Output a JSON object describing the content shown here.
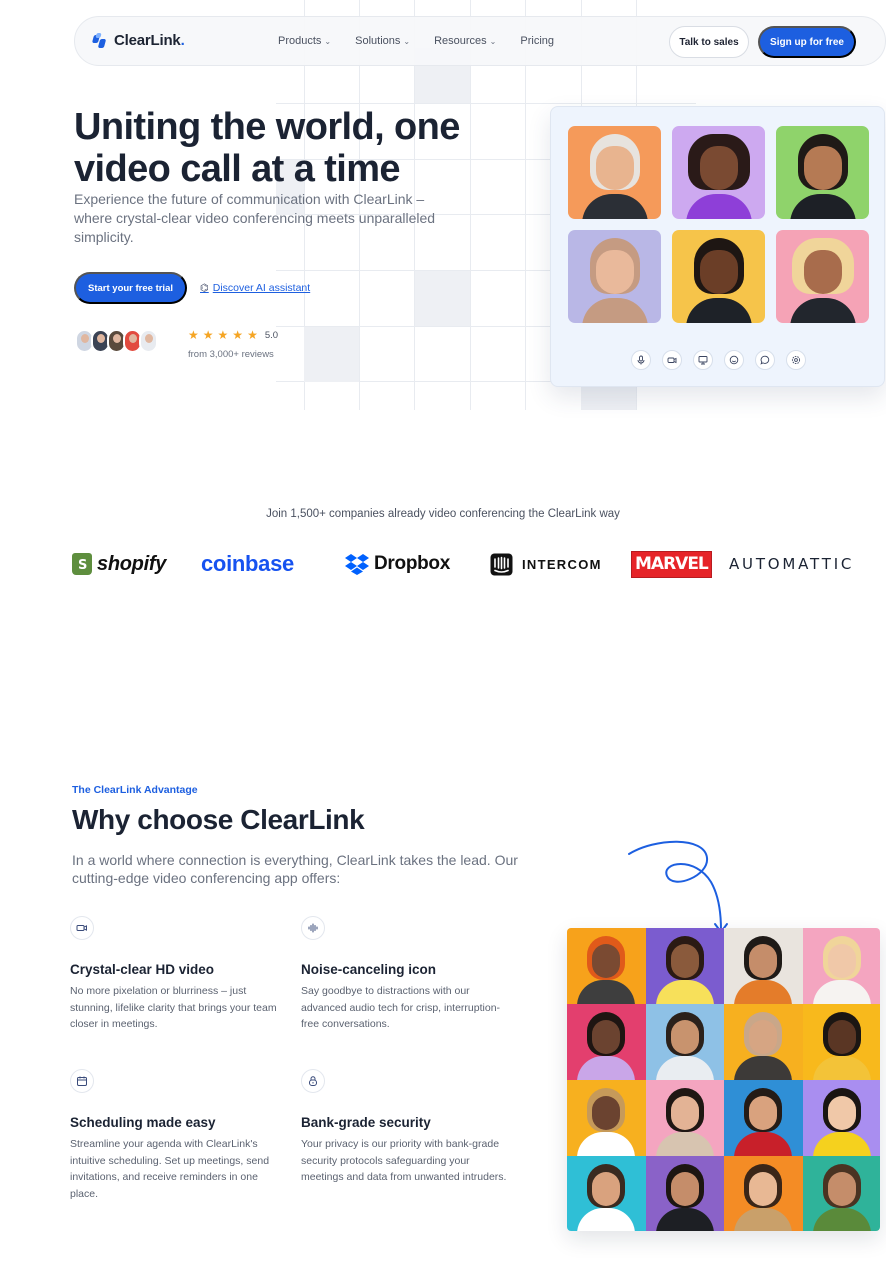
{
  "nav": {
    "brand": "ClearLink",
    "brand_dot": ".",
    "menu": [
      {
        "label": "Products"
      },
      {
        "label": "Solutions"
      },
      {
        "label": "Resources"
      },
      {
        "label": "Pricing"
      }
    ],
    "talk_to_sales": "Talk to sales",
    "sign_up": "Sign up for free"
  },
  "hero": {
    "title": "Uniting the world, one video call at a time",
    "subtitle": "Experience the future of communication with ClearLink – where crystal-clear video conferencing meets unparalleled simplicity.",
    "cta_primary": "Start your free trial",
    "cta_secondary": "Discover AI assistant",
    "rating": "5.0",
    "reviews": "from 3,000+ reviews",
    "star_count": 5
  },
  "video_card": {
    "participants": [
      {
        "name": "older-man-avatar",
        "bg": "#f59a5a"
      },
      {
        "name": "curly-woman-avatar",
        "bg": "#cda9f0"
      },
      {
        "name": "bearded-man-avatar",
        "bg": "#8fd36b"
      },
      {
        "name": "hijab-woman-avatar",
        "bg": "#b9b7e6"
      },
      {
        "name": "glasses-man-avatar",
        "bg": "#f6c44a"
      },
      {
        "name": "blonde-woman-avatar",
        "bg": "#f5a3b6"
      }
    ],
    "controls": [
      {
        "name": "microphone-icon",
        "glyph": "🎙"
      },
      {
        "name": "camera-icon",
        "glyph": "▭"
      },
      {
        "name": "screen-share-icon",
        "glyph": "▢"
      },
      {
        "name": "emoji-icon",
        "glyph": "☺"
      },
      {
        "name": "chat-icon",
        "glyph": "◌"
      },
      {
        "name": "settings-icon",
        "glyph": "⚙"
      }
    ]
  },
  "companies": {
    "heading": "Join 1,500+ companies already video conferencing the ClearLink way",
    "logos": [
      "shopify",
      "coinbase",
      "Dropbox",
      "INTERCOM",
      "MARVEL",
      "AUTOMATTIC"
    ]
  },
  "advantage": {
    "eyebrow": "The ClearLink Advantage",
    "title": "Why choose ClearLink",
    "subtitle": "In a world where connection is everything, ClearLink takes the lead. Our cutting-edge video conferencing app offers:",
    "features": [
      {
        "icon": "video-icon",
        "glyph": "▭",
        "title": "Crystal-clear HD video",
        "desc": "No more pixelation or blurriness – just stunning, lifelike clarity that brings your team closer in meetings."
      },
      {
        "icon": "soundwave-icon",
        "glyph": "⦙",
        "title": "Noise-canceling icon",
        "desc": "Say goodbye to distractions with our advanced audio tech for crisp, interruption-free conversations."
      },
      {
        "icon": "calendar-icon",
        "glyph": "▤",
        "title": "Scheduling made easy",
        "desc": "Streamline your agenda with ClearLink's intuitive scheduling. Set up meetings, send invitations, and receive reminders in one place."
      },
      {
        "icon": "lock-icon",
        "glyph": "⊕",
        "title": "Bank-grade security",
        "desc": "Your privacy is our priority with bank-grade security protocols safeguarding your meetings and data from unwanted intruders."
      }
    ]
  },
  "colors": {
    "primary": "#1d5fe0",
    "heading": "#1b2333",
    "muted": "#6b7280",
    "star": "#f5a524"
  },
  "people_grid": [
    "#f7a21b",
    "#7b5ccf",
    "#e9e4de",
    "#f4a5c0",
    "#e33f6e",
    "#8ec1e6",
    "#f7b01f",
    "#f8b91c",
    "#f7b01f",
    "#f4a5c0",
    "#2f8fd6",
    "#a98ef0",
    "#2fbfd6",
    "#8a62c8",
    "#f48c25",
    "#2fb39a"
  ]
}
